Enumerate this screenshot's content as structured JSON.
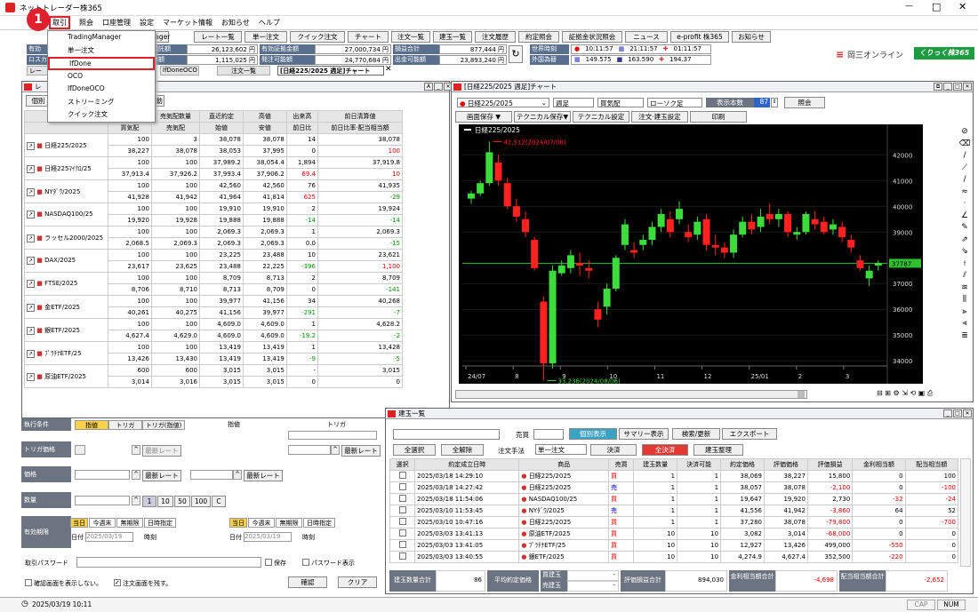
{
  "app_title": "ネットトレーダー株365",
  "window_controls": {
    "minimize": "—",
    "maximize": "□",
    "close": "✕"
  },
  "menu": [
    "取引",
    "照会",
    "口座管理",
    "設定",
    "マーケット情報",
    "お知らせ",
    "ヘルプ"
  ],
  "dropdown": [
    "TradingManager",
    "単一注文",
    "IfDone",
    "OCO",
    "IfDoneOCO",
    "ストリーミング",
    "クイック注文"
  ],
  "badge": "1",
  "toolbar_buttons": [
    "TradingManager",
    "レート一覧",
    "単一注文",
    "クイック注文",
    "チャート",
    "注文一覧",
    "建玉一覧",
    "注文履歴",
    "約定照会",
    "証拠金状況照会",
    "ニュース",
    "e-profit 株365",
    "お知らせ"
  ],
  "account": {
    "r1": [
      {
        "l": "有効",
        "v": ""
      },
      {
        "l": "証拠金預託額",
        "v": "26,123,602 円"
      },
      {
        "l": "有効証拠金額",
        "v": "27,000,734 円"
      },
      {
        "l": "損益合計",
        "v": "877,444 円"
      }
    ],
    "r2": [
      {
        "l": "ロスカ",
        "v": ""
      },
      {
        "l": "ット基準額",
        "v": "1,115,025 円"
      },
      {
        "l": "発注可能額",
        "v": "24,770,684 円"
      },
      {
        "l": "出金可能額",
        "v": "23,893,240 円"
      }
    ]
  },
  "world_clock": {
    "label": "世界時刻",
    "times": [
      "10:11:57",
      "21:11:57",
      "01:11:57"
    ]
  },
  "fx": {
    "label": "外国為替",
    "rates": [
      "149.575",
      "163.590",
      "194.37"
    ]
  },
  "brand": "岡三オンライン",
  "brand_badge": "くりっく株365",
  "window_tabs": [
    "レー",
    "IfDoneOCO",
    "注文一覧",
    "[日経225/2025 週足]チャート"
  ],
  "rate_panel": {
    "title": "レ",
    "tab": "個別",
    "action": "動",
    "headers1": [
      "",
      "買気配",
      "売気配数量",
      "直近約定",
      "高値",
      "出来高",
      "前日清算値"
    ],
    "headers2": [
      "",
      "買気配",
      "売気配",
      "始値",
      "安値",
      "前日比",
      "前日比率·配当相当額"
    ],
    "rows": [
      {
        "name": "日経225/2025",
        "a": [
          "100",
          "3",
          "38,078",
          "38,078",
          "14",
          "38,078"
        ],
        "b": [
          "38,227",
          "38,078",
          "38,053",
          "37,995",
          "0",
          "100"
        ],
        "bcls": "red"
      },
      {
        "name": "日経225ﾏｲｸﾛ/25",
        "a": [
          "100",
          "100",
          "37,989.2",
          "38,054.4",
          "1,894",
          "37,919.8"
        ],
        "b": [
          "37,913.4",
          "37,926.2",
          "37,993.4",
          "37,906.2",
          "69.4",
          "10"
        ],
        "bcls": "red"
      },
      {
        "name": "NYﾀﾞｳ/2025",
        "a": [
          "100",
          "100",
          "42,560",
          "42,560",
          "76",
          "41,935"
        ],
        "b": [
          "41,928",
          "41,942",
          "41,964",
          "41,814",
          "625",
          "-29"
        ],
        "bcls": "grn"
      },
      {
        "name": "NASDAQ100/25",
        "a": [
          "100",
          "100",
          "19,910",
          "19,910",
          "2",
          "19,924"
        ],
        "b": [
          "19,920",
          "19,928",
          "19,888",
          "19,888",
          "-14",
          "-14"
        ],
        "bcls": "grn"
      },
      {
        "name": "ラッセル2000/2025",
        "a": [
          "100",
          "100",
          "2,069.3",
          "2,069.3",
          "1",
          "2,069.3"
        ],
        "b": [
          "2,068.5",
          "2,069.3",
          "2,069.3",
          "2,069.3",
          "0.0",
          "-15"
        ],
        "bcls": "grn"
      },
      {
        "name": "DAX/2025",
        "a": [
          "100",
          "100",
          "23,225",
          "23,488",
          "10",
          "23,621"
        ],
        "b": [
          "23,617",
          "23,625",
          "23,488",
          "22,225",
          "-396",
          "1,100"
        ],
        "bcls": "red"
      },
      {
        "name": "FTSE/2025",
        "a": [
          "100",
          "100",
          "8,709",
          "8,713",
          "2",
          "8,709"
        ],
        "b": [
          "8,706",
          "8,710",
          "8,713",
          "8,709",
          "0",
          "-141"
        ],
        "bcls": "grn"
      },
      {
        "name": "金ETF/2025",
        "a": [
          "100",
          "100",
          "39,977",
          "41,156",
          "34",
          "40,268"
        ],
        "b": [
          "40,261",
          "40,275",
          "41,156",
          "39,977",
          "-291",
          "-7"
        ],
        "bcls": "grn"
      },
      {
        "name": "銀ETF/2025",
        "a": [
          "100",
          "100",
          "4,609.0",
          "4,609.0",
          "1",
          "4,628.2"
        ],
        "b": [
          "4,627.4",
          "4,629.0",
          "4,609.0",
          "4,609.0",
          "-19.2",
          "-2"
        ],
        "bcls": "grn"
      },
      {
        "name": "ﾌﾟﾗﾁﾅETF/25",
        "a": [
          "100",
          "100",
          "13,419",
          "13,419",
          "1",
          "13,428"
        ],
        "b": [
          "13,426",
          "13,430",
          "13,419",
          "13,419",
          "-9",
          "-5"
        ],
        "bcls": "grn"
      },
      {
        "name": "原油ETF/2025",
        "a": [
          "600",
          "600",
          "3,015",
          "3,015",
          "-",
          "3,015"
        ],
        "b": [
          "3,014",
          "3,016",
          "3,015",
          "3,015",
          "0",
          "0"
        ],
        "bcls": ""
      }
    ]
  },
  "order_form": {
    "rows": [
      "執行条件",
      "トリガ価格",
      "価格",
      "数量",
      "有効期限"
    ],
    "cond_tabs": [
      "指値",
      "トリガ",
      "トリガ(指値)"
    ],
    "col2": "指値",
    "col3": "トリガ",
    "best_rate": "最新レート",
    "qty_presets": [
      "1",
      "10",
      "50",
      "100",
      "C"
    ],
    "expiry": [
      "当日",
      "今週末",
      "無期限",
      "日時指定"
    ],
    "date_label": "日付",
    "date_value": "2025/03/19",
    "time_label": "時刻",
    "pw_label": "取引パスワード",
    "save": "保存",
    "show_pw": "パスワード表示",
    "no_confirm": "確認画面を表示しない。",
    "keep": "注文画面を残す。",
    "confirm_btn": "確認",
    "clear_btn": "クリア"
  },
  "chart_panel": {
    "title": "[日経225/2025 週足]チャート",
    "symbol": "日経225/2025",
    "period": "週足",
    "price_type": "買気配",
    "candle": "ローソク足",
    "display_count_label": "表示本数",
    "display_count": "87",
    "lookup": "照会",
    "buttons": [
      "画面保存 ▼",
      "テクニカル保存▼",
      "テクニカル設定",
      "注文·建玉設定",
      "印刷"
    ]
  },
  "chart_data": {
    "type": "candlestick",
    "title": "日経225/2025",
    "y_ticks": [
      "42000",
      "41000",
      "40000",
      "39000",
      "37000",
      "36000",
      "35000",
      "34000"
    ],
    "ylim": [
      33800,
      42700
    ],
    "x_ticks": [
      "24/07",
      "8",
      "9",
      "10",
      "11",
      "12",
      "25/01",
      "2",
      "3"
    ],
    "current_price": "37787",
    "high_annotation": "42,512(2024/07/08)",
    "low_annotation": "33,236(2024/08/06)",
    "candles": [
      {
        "o": 40300,
        "h": 40600,
        "l": 40100,
        "c": 40500
      },
      {
        "o": 40500,
        "h": 41000,
        "l": 40400,
        "c": 40900
      },
      {
        "o": 40900,
        "h": 42512,
        "l": 40800,
        "c": 42100
      },
      {
        "o": 41700,
        "h": 42000,
        "l": 40800,
        "c": 41000
      },
      {
        "o": 40900,
        "h": 41100,
        "l": 39900,
        "c": 40000
      },
      {
        "o": 40000,
        "h": 40300,
        "l": 39400,
        "c": 39600
      },
      {
        "o": 39500,
        "h": 39800,
        "l": 38800,
        "c": 39000
      },
      {
        "o": 38700,
        "h": 38800,
        "l": 37500,
        "c": 37600
      },
      {
        "o": 36300,
        "h": 36500,
        "l": 33236,
        "c": 33900
      },
      {
        "o": 33900,
        "h": 37700,
        "l": 33700,
        "c": 37500
      },
      {
        "o": 37400,
        "h": 37900,
        "l": 37300,
        "c": 37700
      },
      {
        "o": 37600,
        "h": 38300,
        "l": 37400,
        "c": 38100
      },
      {
        "o": 37800,
        "h": 38200,
        "l": 37300,
        "c": 37700
      },
      {
        "o": 37600,
        "h": 37900,
        "l": 37200,
        "c": 37500
      },
      {
        "o": 36000,
        "h": 36300,
        "l": 35300,
        "c": 35600
      },
      {
        "o": 36100,
        "h": 37000,
        "l": 35800,
        "c": 36800
      },
      {
        "o": 36800,
        "h": 38100,
        "l": 36700,
        "c": 38000
      },
      {
        "o": 38500,
        "h": 39500,
        "l": 38300,
        "c": 39300
      },
      {
        "o": 38300,
        "h": 38600,
        "l": 38000,
        "c": 38200
      },
      {
        "o": 38500,
        "h": 38900,
        "l": 38300,
        "c": 38700
      },
      {
        "o": 38700,
        "h": 39400,
        "l": 38500,
        "c": 39200
      },
      {
        "o": 39200,
        "h": 39900,
        "l": 39000,
        "c": 39700
      },
      {
        "o": 39500,
        "h": 39800,
        "l": 38800,
        "c": 39000
      },
      {
        "o": 39500,
        "h": 40200,
        "l": 39300,
        "c": 39900
      },
      {
        "o": 39000,
        "h": 39300,
        "l": 38600,
        "c": 38800
      },
      {
        "o": 38900,
        "h": 39600,
        "l": 38700,
        "c": 39400
      },
      {
        "o": 39500,
        "h": 39700,
        "l": 38300,
        "c": 38500
      },
      {
        "o": 38500,
        "h": 38900,
        "l": 38100,
        "c": 38400
      },
      {
        "o": 38400,
        "h": 38600,
        "l": 38000,
        "c": 38200
      },
      {
        "o": 38200,
        "h": 39100,
        "l": 38000,
        "c": 38900
      },
      {
        "o": 38900,
        "h": 39600,
        "l": 38800,
        "c": 39400
      },
      {
        "o": 39400,
        "h": 39700,
        "l": 38900,
        "c": 39100
      },
      {
        "o": 39200,
        "h": 39900,
        "l": 39000,
        "c": 39600
      },
      {
        "o": 39700,
        "h": 40100,
        "l": 39300,
        "c": 39500
      },
      {
        "o": 39500,
        "h": 39900,
        "l": 39200,
        "c": 39700
      },
      {
        "o": 39700,
        "h": 39800,
        "l": 38800,
        "c": 39000
      },
      {
        "o": 38900,
        "h": 39200,
        "l": 38700,
        "c": 39000
      },
      {
        "o": 39000,
        "h": 39800,
        "l": 38900,
        "c": 39700
      },
      {
        "o": 39500,
        "h": 39800,
        "l": 39100,
        "c": 39300
      },
      {
        "o": 39400,
        "h": 39600,
        "l": 38900,
        "c": 39000
      },
      {
        "o": 39100,
        "h": 39500,
        "l": 38900,
        "c": 39300
      },
      {
        "o": 39200,
        "h": 39400,
        "l": 38600,
        "c": 38800
      },
      {
        "o": 38700,
        "h": 38900,
        "l": 38200,
        "c": 38400
      },
      {
        "o": 37900,
        "h": 38100,
        "l": 37500,
        "c": 37600
      },
      {
        "o": 37200,
        "h": 37700,
        "l": 36900,
        "c": 37500
      },
      {
        "o": 37700,
        "h": 37900,
        "l": 37500,
        "c": 37800
      }
    ]
  },
  "positions": {
    "title": "建玉一覧",
    "side_label": "売買",
    "buttons": [
      "個別表示",
      "サマリー表示",
      "検索/更新",
      "エクスポート"
    ],
    "buttons2": [
      "全選択",
      "全解除",
      "注文手法",
      "単一注文",
      "決済",
      "全決済",
      "建玉整理"
    ],
    "headers": [
      "選択",
      "約定成立日時",
      "商品",
      "売買",
      "建玉数量",
      "決済可能",
      "約定価格",
      "評価価格",
      "評価損益",
      "金利相当額",
      "配当相当額"
    ],
    "rows": [
      [
        "2025/03/18 14:29:10",
        "日経225/2025",
        "買",
        "1",
        "1",
        "38,069",
        "38,227",
        "15,800",
        "0",
        "100"
      ],
      [
        "2025/03/18 14:27:42",
        "日経225/2025",
        "売",
        "1",
        "1",
        "38,057",
        "38,078",
        "-2,100",
        "0",
        "-100"
      ],
      [
        "2025/03/18 11:54:06",
        "NASDAQ100/25",
        "買",
        "1",
        "1",
        "19,647",
        "19,920",
        "2,730",
        "-32",
        "-24"
      ],
      [
        "2025/03/10 11:53:45",
        "NYﾀﾞｳ/2025",
        "売",
        "1",
        "1",
        "41,556",
        "41,942",
        "-3,860",
        "64",
        "52"
      ],
      [
        "2025/03/10 10:47:16",
        "日経225/2025",
        "買",
        "1",
        "1",
        "37,280",
        "38,078",
        "-79,800",
        "0",
        "-700"
      ],
      [
        "2025/03/03 13:41:13",
        "原油ETF/2025",
        "買",
        "10",
        "10",
        "3,082",
        "3,014",
        "-68,000",
        "0",
        "0"
      ],
      [
        "2025/03/03 13:41:05",
        "ﾌﾟﾗﾁﾅETF/25",
        "買",
        "10",
        "10",
        "12,927",
        "13,426",
        "499,000",
        "-550",
        "0"
      ],
      [
        "2025/03/03 13:40:55",
        "銀ETF/2025",
        "買",
        "10",
        "10",
        "4,274.9",
        "4,627.4",
        "352,500",
        "-220",
        "0"
      ]
    ],
    "footer": {
      "qty_label": "建玉数量合計",
      "qty": "86",
      "avg_label": "平均約定価格",
      "buy_label": "買建玉",
      "sell_label": "売建玉",
      "eval_label": "評価損益合計",
      "eval": "894,030",
      "int_label": "金利相当額合計",
      "int": "-4,698",
      "div_label": "配当相当額合計",
      "div": "-2,652"
    }
  },
  "status": {
    "datetime": "2025/03/19 10:11",
    "caps": "CAP",
    "num": "NUM"
  }
}
